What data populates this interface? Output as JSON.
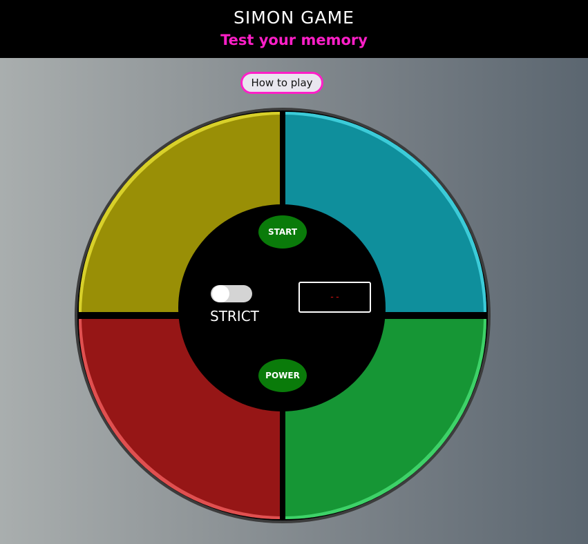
{
  "header": {
    "title": "SIMON GAME",
    "subtitle": "Test your memory"
  },
  "how_to_play": {
    "label": "How to play"
  },
  "board": {
    "quadrants": [
      {
        "color": "yellow",
        "fill": "#998f06"
      },
      {
        "color": "blue",
        "fill": "#0f8f9c"
      },
      {
        "color": "red",
        "fill": "#961616"
      },
      {
        "color": "green",
        "fill": "#169635"
      }
    ],
    "start_label": "START",
    "power_label": "POWER",
    "strict_label": "STRICT",
    "strict_on": false,
    "count_display": "--"
  },
  "colors": {
    "accent": "#ff1fc8",
    "button_green": "#0a7b0a",
    "display_red": "#d81010"
  }
}
